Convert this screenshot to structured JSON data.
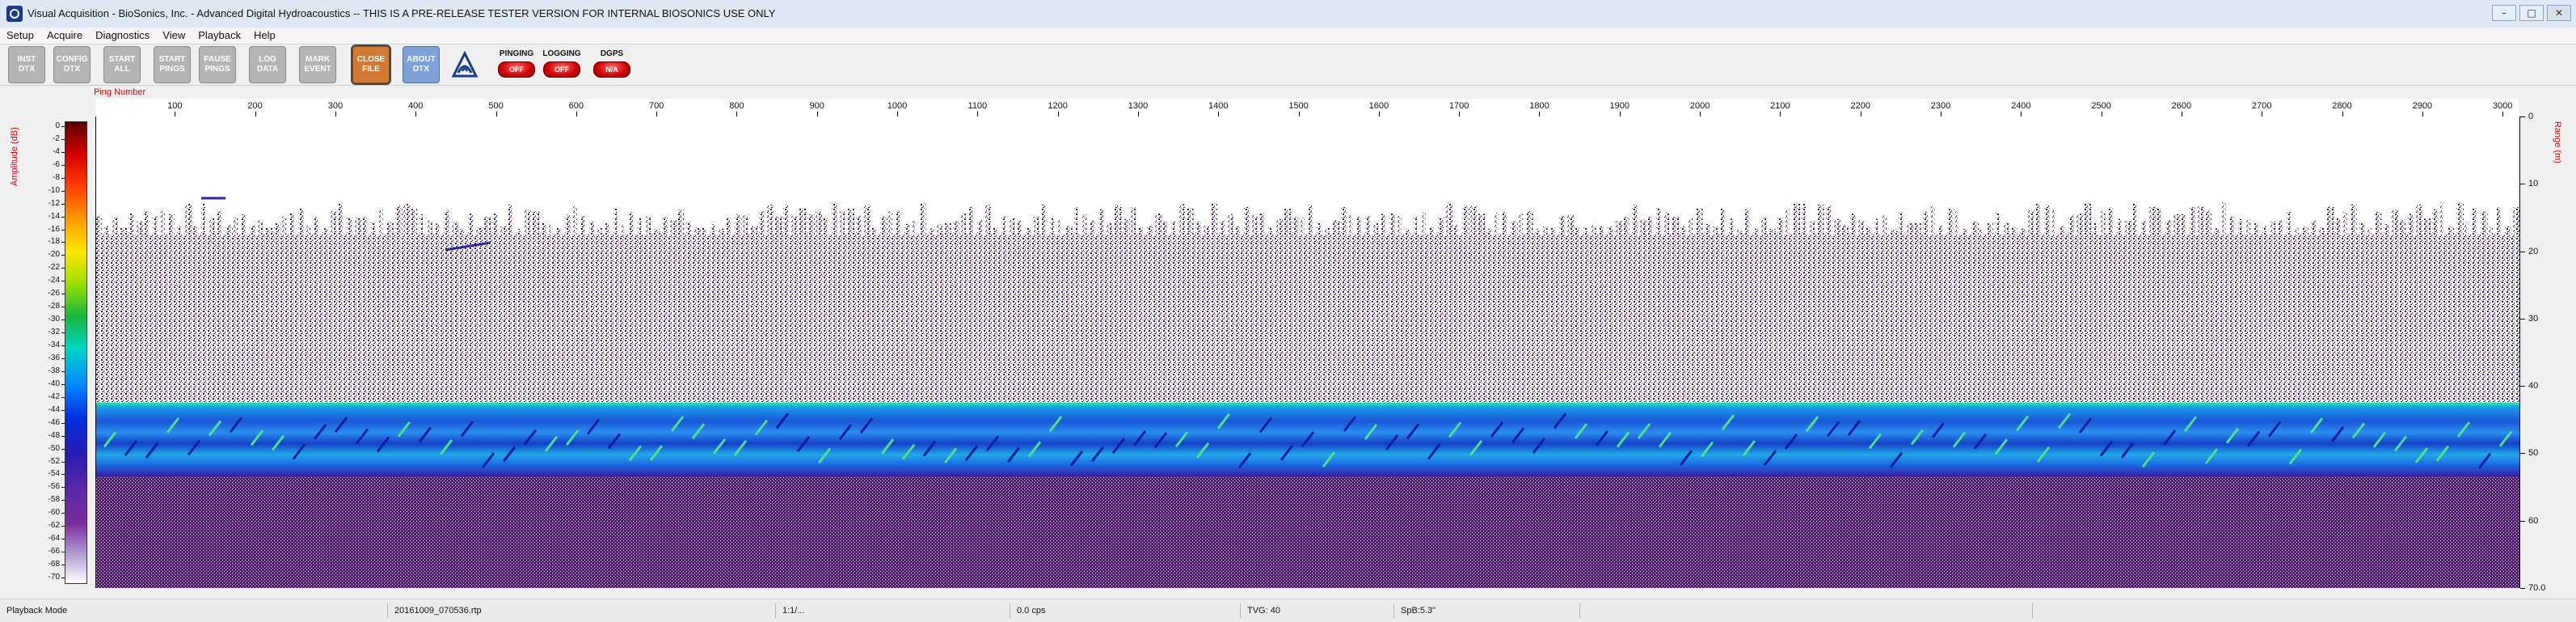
{
  "window": {
    "title": "Visual Acquisition  -  BioSonics, Inc.  -  Advanced Digital Hydroacoustics  --  THIS IS A PRE-RELEASE TESTER VERSION FOR INTERNAL BIOSONICS USE ONLY"
  },
  "menu": [
    "Setup",
    "Acquire",
    "Diagnostics",
    "View",
    "Playback",
    "Help"
  ],
  "toolbar": {
    "buttons": [
      {
        "name": "inst-dtx-button",
        "label": "INST DTX"
      },
      {
        "name": "config-dtx-button",
        "label": "CONFIG DTX"
      },
      {
        "name": "start-all-button",
        "label": "START ALL"
      },
      {
        "name": "start-pings-button",
        "label": "START PINGS"
      },
      {
        "name": "pause-pings-button",
        "label": "PAUSE PINGS"
      },
      {
        "name": "log-data-button",
        "label": "LOG DATA"
      },
      {
        "name": "mark-event-button",
        "label": "MARK EVENT"
      },
      {
        "name": "close-file-button",
        "label": "CLOSE FILE"
      },
      {
        "name": "about-dtx-button",
        "label": "ABOUT DTX"
      }
    ],
    "indicators": [
      {
        "name": "pinging-indicator",
        "label": "PINGING",
        "state": "OFF"
      },
      {
        "name": "logging-indicator",
        "label": "LOGGING",
        "state": "OFF"
      },
      {
        "name": "dgps-indicator",
        "label": "DGPS",
        "state": "N/A"
      }
    ]
  },
  "echogram": {
    "x_axis_title": "Ping Number",
    "x_ticks": [
      100,
      200,
      300,
      400,
      500,
      600,
      700,
      800,
      900,
      1000,
      1100,
      1200,
      1300,
      1400,
      1500,
      1600,
      1700,
      1800,
      1900,
      2000,
      2100,
      2200,
      2300,
      2400,
      2500,
      2600,
      2700,
      2800,
      2900,
      3000
    ],
    "x_range": [
      1,
      3020
    ],
    "y_axis_title": "Range (m)",
    "y_ticks": [
      "0",
      "10",
      "20",
      "30",
      "40",
      "50",
      "60",
      "70.0"
    ],
    "y_range": [
      0,
      70
    ],
    "colorbar_title": "Amplitude (dB)",
    "colorbar_ticks": [
      "0",
      "-2",
      "-4",
      "-6",
      "-8",
      "-10",
      "-12",
      "-14",
      "-16",
      "-18",
      "-20",
      "-22",
      "-24",
      "-26",
      "-28",
      "-30",
      "-32",
      "-34",
      "-36",
      "-38",
      "-40",
      "-42",
      "-44",
      "-46",
      "-48",
      "-50",
      "-52",
      "-54",
      "-56",
      "-58",
      "-60",
      "-62",
      "-64",
      "-66",
      "-68",
      "-70"
    ],
    "bottom_band_range_m": [
      42.5,
      53.5
    ],
    "noise_top_range_m": 17.5,
    "colors": {
      "bottom_band": "#1f7fe8",
      "noise": "#4b1370",
      "bottom_highlight": "#22d3b6"
    }
  },
  "statusbar": {
    "mode": "Playback Mode",
    "file": "20161009_070536.rtp",
    "ratio": "1:1/...",
    "rate": "0.0 cps",
    "tvg": "TVG: 40",
    "sp": "SpB:5.3\""
  }
}
